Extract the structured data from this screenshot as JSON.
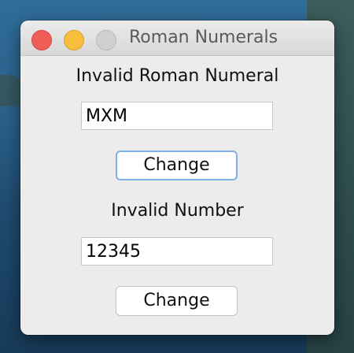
{
  "window": {
    "title": "Roman Numerals"
  },
  "roman_section": {
    "status": "Invalid Roman Numeral",
    "input_value": "MXM",
    "button_label": "Change"
  },
  "number_section": {
    "status": "Invalid Number",
    "input_value": "12345",
    "button_label": "Change"
  },
  "colors": {
    "close": "#ee5e57",
    "minimize": "#f6be3c",
    "zoom_disabled": "#d0d0d0",
    "focus_ring": "#7fb0e8"
  }
}
